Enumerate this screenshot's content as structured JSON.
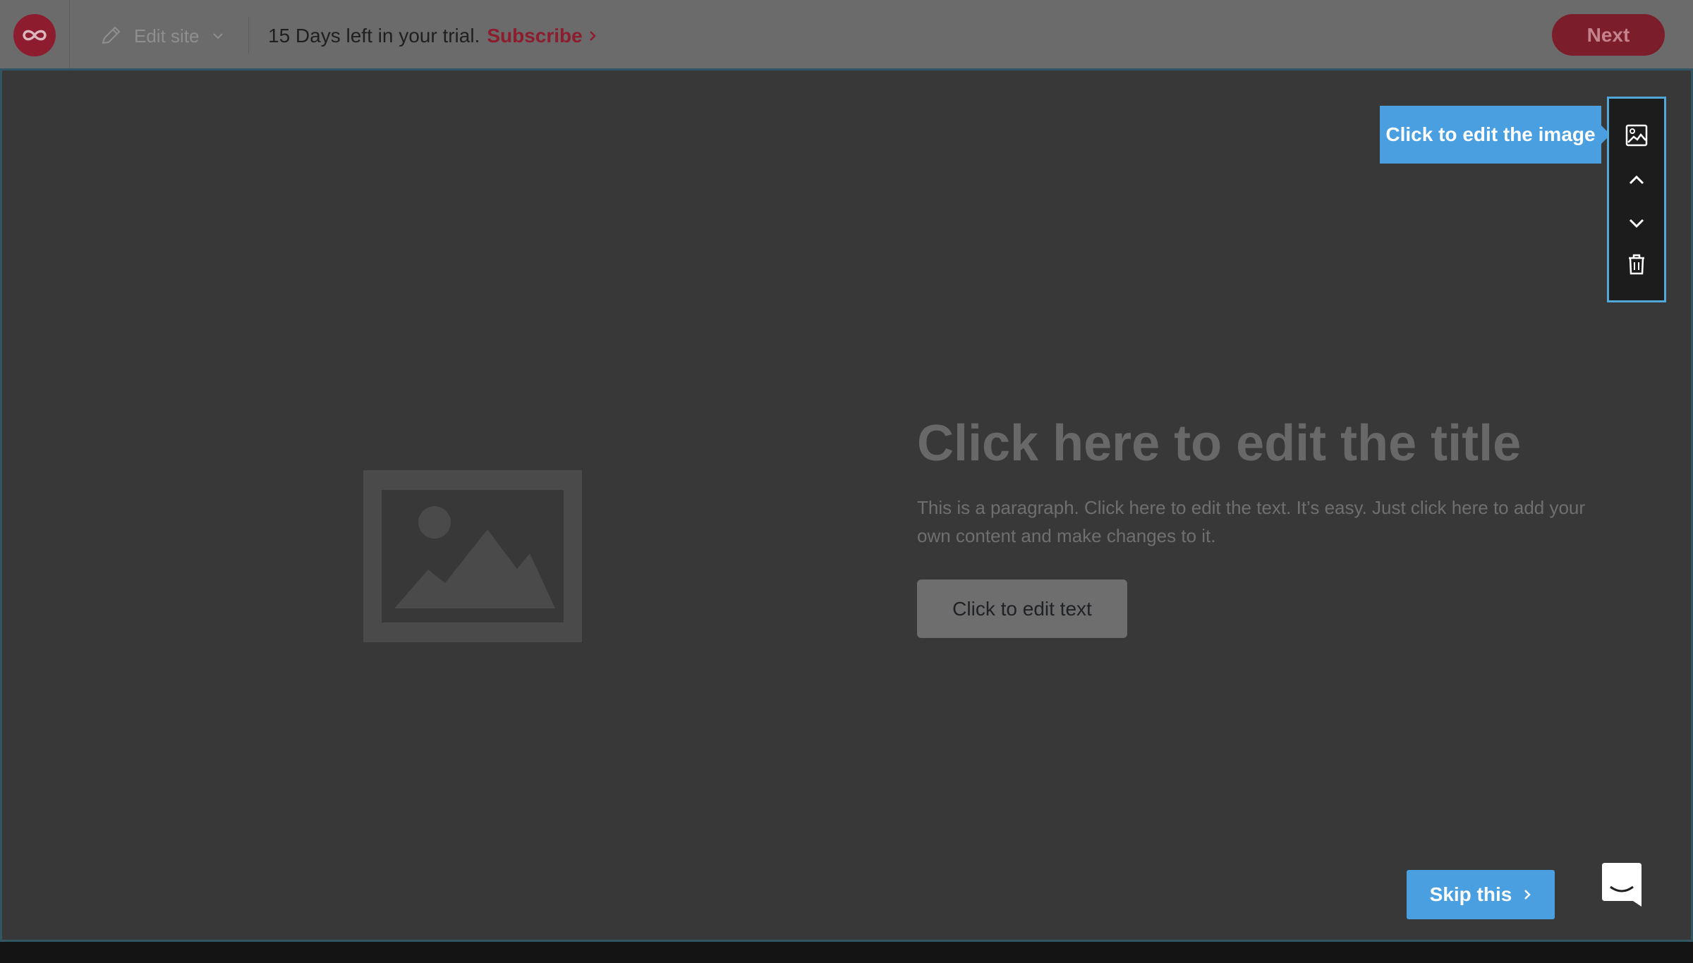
{
  "topbar": {
    "edit_site_label": "Edit site",
    "trial_text": "15 Days left in your trial.",
    "subscribe_label": "Subscribe",
    "next_label": "Next"
  },
  "content": {
    "title": "Click here to edit the title",
    "paragraph": "This is a paragraph. Click here to edit the text. It’s easy. Just click here to add your own content and make changes to it.",
    "button_label": "Click to edit text"
  },
  "toolbar": {
    "tooltip": "Click to edit the image",
    "buttons": [
      "image-icon",
      "chevron-up-icon",
      "chevron-down-icon",
      "trash-icon"
    ]
  },
  "footer": {
    "skip_label": "Skip this"
  },
  "colors": {
    "brand": "#8c1c2e",
    "accent": "#4a9fe1",
    "canvas": "#383838",
    "topbar": "#6b6b6b"
  }
}
